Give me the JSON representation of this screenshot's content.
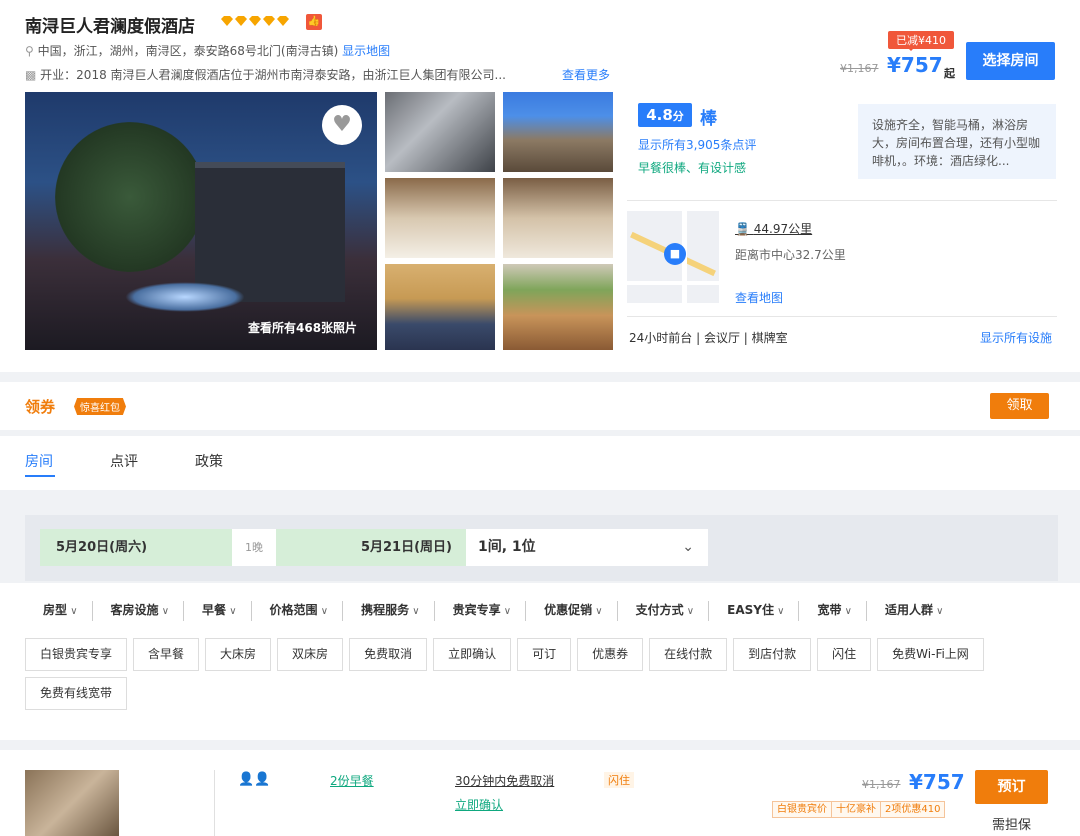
{
  "hotel": {
    "name": "南浔巨人君澜度假酒店",
    "address": "中国，浙江，湖州，南浔区，泰安路68号北门(南浔古镇)",
    "show_map": "显示地图",
    "intro": "开业：2018  南浔巨人君澜度假酒店位于湖州市南浔泰安路，由浙江巨人集团有限公司...",
    "see_more": "查看更多",
    "rating_icon": "diamond-icon"
  },
  "pricing": {
    "discount_badge": "已减¥410",
    "original": "¥1,167",
    "price": "¥757",
    "from_label": "起",
    "select_room": "选择房间"
  },
  "photos": {
    "view_all": "查看所有468张照片"
  },
  "review": {
    "score": "4.8",
    "score_unit": "分",
    "word": "棒",
    "count_link": "显示所有3,905条点评",
    "tagline": "早餐很棒、有设计感",
    "quote": "设施齐全，智能马桶，淋浴房大，房间布置合理，还有小型咖啡机，。环境：酒店绿化..."
  },
  "location": {
    "distance": "44.97公里",
    "center": "距离市中心32.7公里",
    "view_map": "查看地图"
  },
  "facilities": {
    "list": "24小时前台 | 会议厅 | 棋牌室",
    "show_all": "显示所有设施"
  },
  "coupon": {
    "label": "领券",
    "tag": "惊喜红包",
    "claim": "领取"
  },
  "tabs": [
    {
      "label": "房间"
    },
    {
      "label": "点评"
    },
    {
      "label": "政策"
    }
  ],
  "booking": {
    "checkin": "5月20日(周六)",
    "nights": "1晚",
    "checkout": "5月21日(周日)",
    "guests": "1间, 1位"
  },
  "filters": [
    "房型",
    "客房设施",
    "早餐",
    "价格范围",
    "携程服务",
    "贵宾专享",
    "优惠促销",
    "支付方式",
    "EASY住",
    "宽带",
    "适用人群"
  ],
  "chips": [
    "白银贵宾专享",
    "含早餐",
    "大床房",
    "双床房",
    "免费取消",
    "立即确认",
    "可订",
    "优惠券",
    "在线付款",
    "到店付款",
    "闪住",
    "免费Wi-Fi上网",
    "免费有线宽带"
  ],
  "room": {
    "breakfast": "2份早餐",
    "cancel": "30分钟内免费取消",
    "confirm": "立即确认",
    "flash": "闪住",
    "original": "¥1,167",
    "price": "¥757",
    "promos": [
      "白银贵宾价",
      "十亿豪补",
      "2项优惠410"
    ],
    "book": "预订",
    "guarantee": "需担保"
  }
}
